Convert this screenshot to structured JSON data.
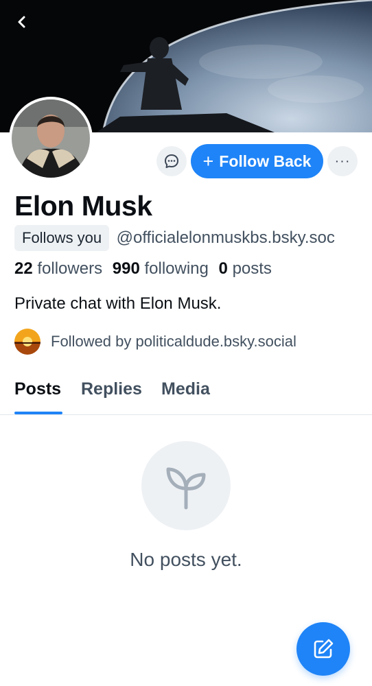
{
  "profile": {
    "name": "Elon Musk",
    "follows_badge": "Follows you",
    "handle": "@officialelonmuskbs.bsky.soc",
    "bio": "Private chat with Elon Musk.",
    "followed_by": "Followed by politicaldude.bsky.social"
  },
  "stats": {
    "followers_count": "22",
    "followers_label": "followers",
    "following_count": "990",
    "following_label": "following",
    "posts_count": "0",
    "posts_label": "posts"
  },
  "actions": {
    "follow_back_label": "Follow Back",
    "more_label": "···"
  },
  "tabs": [
    {
      "label": "Posts",
      "active": true
    },
    {
      "label": "Replies",
      "active": false
    },
    {
      "label": "Media",
      "active": false
    }
  ],
  "empty_state": {
    "message": "No posts yet."
  },
  "icons": {
    "back": "chevron-left-icon",
    "chat": "chat-bubble-icon",
    "more": "ellipsis-icon",
    "empty": "sprout-icon",
    "compose": "compose-icon"
  },
  "colors": {
    "accent": "#1f84f7",
    "muted_text": "#42505f",
    "surface": "#eef1f4"
  }
}
